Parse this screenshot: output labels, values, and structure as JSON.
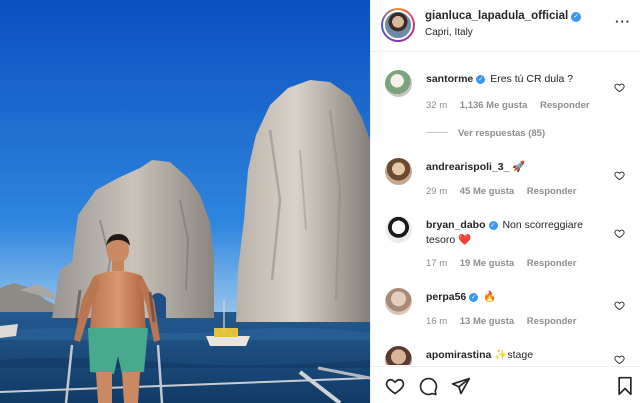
{
  "post": {
    "username": "gianluca_lapadula_official",
    "location": "Capri, Italy",
    "more_label": "···"
  },
  "comments": [
    {
      "user": "santorme",
      "verified": true,
      "text": "Eres tú CR dula ?",
      "time": "32 m",
      "likes": "1,136 Me gusta",
      "reply": "Responder"
    },
    {
      "user": "andrearispoli_3_",
      "verified": false,
      "text": "🚀",
      "time": "29 m",
      "likes": "45 Me gusta",
      "reply": "Responder"
    },
    {
      "user": "bryan_dabo",
      "verified": true,
      "text": "Non scorreggiare tesoro ❤️",
      "time": "17 m",
      "likes": "19 Me gusta",
      "reply": "Responder"
    },
    {
      "user": "perpa56",
      "verified": true,
      "text": "🔥",
      "time": "16 m",
      "likes": "13 Me gusta",
      "reply": "Responder"
    },
    {
      "user": "apomirastina",
      "verified": false,
      "text": "✨stage",
      "time": "",
      "likes": "",
      "reply": ""
    }
  ],
  "replies_label": "Ver respuestas (85)",
  "actions": [
    "like-icon",
    "comment-icon",
    "share-icon",
    "save-icon"
  ],
  "colors": {
    "verified": "#3897f0",
    "meta": "#8e8e8e",
    "text": "#262626",
    "sea": "#1e4f8a",
    "sky": "#1f6fd6"
  }
}
